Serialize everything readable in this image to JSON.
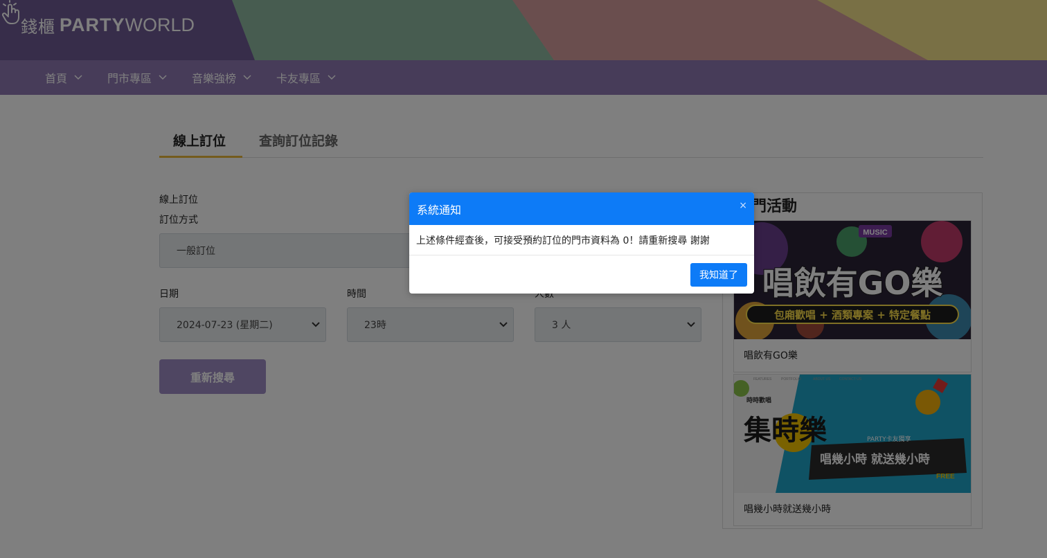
{
  "brand": {
    "cn": "錢櫃",
    "party": "PARTY",
    "world": "WORLD"
  },
  "nav": {
    "items": [
      {
        "label": "首頁"
      },
      {
        "label": "門市專區"
      },
      {
        "label": "音樂強榜"
      },
      {
        "label": "卡友專區"
      }
    ]
  },
  "tabs": {
    "active": "線上訂位",
    "inactive": "查詢訂位記錄"
  },
  "form": {
    "section_title": "線上訂位",
    "mode_label": "訂位方式",
    "mode_value": "一般訂位",
    "date_label": "日期",
    "date_value": "2024-07-23 (星期二)",
    "time_label": "時間",
    "time_value": "23時",
    "people_label": "人數",
    "people_value": "3 人",
    "search_button": "重新搜尋"
  },
  "sidebar": {
    "title": "熱門活動",
    "promos": [
      {
        "caption": "唱飲有GO樂",
        "img_title": "唱飲有GO樂",
        "img_sub": "包廂歡唱 + 酒類專案 + 特定餐點",
        "img_tag": "MUSIC"
      },
      {
        "caption": "唱幾小時就送幾小時",
        "img_title": "集時樂",
        "img_sub": "唱幾小時 就送幾小時",
        "img_tag": "時時歡唱",
        "img_ribbon": "PARTY卡友獨享",
        "img_free": "FREE",
        "img_nav": [
          "FEATURES",
          "PORTFOLIO",
          "ABOUT US",
          "CONTACT US"
        ]
      }
    ]
  },
  "modal": {
    "title": "系統通知",
    "close": "×",
    "message": "上述條件經查後，可接受預約訂位的門市資料為 0！請重新搜尋 謝謝",
    "button": "我知道了"
  },
  "colors": {
    "banner_purple": "#6f5b95",
    "banner_green": "#8fb8a0",
    "banner_pink": "#d49d9c",
    "banner_yellow": "#f3e08a",
    "nav": "#8e78b2",
    "modal_accent": "#0d7bf7",
    "tab_underline": "#e8b73a"
  }
}
